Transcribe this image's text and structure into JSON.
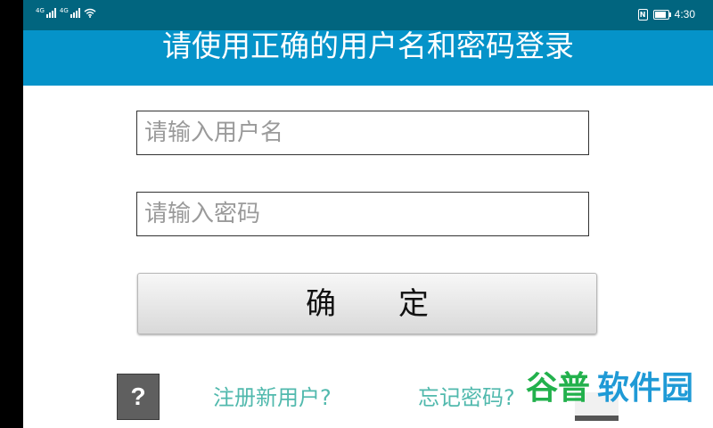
{
  "status_bar": {
    "network_left": "4G",
    "network_right": "4G",
    "time": "4:30",
    "battery_level": 0.85,
    "icons": [
      "signal-icon",
      "signal-icon",
      "wifi-icon",
      "nfc-icon",
      "battery-icon"
    ]
  },
  "header": {
    "title": "请使用正确的用户名和密码登录",
    "background_color": "#0593c9"
  },
  "form": {
    "username_placeholder": "请输入用户名",
    "username_value": "",
    "password_placeholder": "请输入密码",
    "password_value": ""
  },
  "confirm_button": {
    "label": "确定"
  },
  "footer": {
    "help_label": "?",
    "register_label": "注册新用户?",
    "forgot_label": "忘记密码?",
    "link_color": "#51b9ad"
  },
  "watermark": {
    "text": "谷普软件园"
  }
}
